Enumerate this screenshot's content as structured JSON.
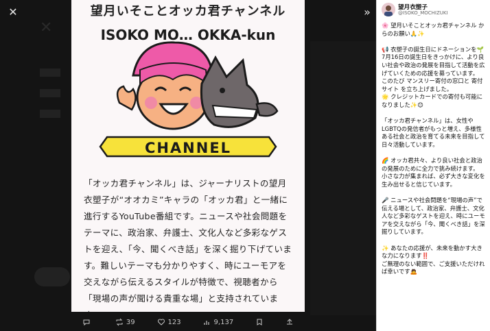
{
  "top": {
    "close_glyph": "✕",
    "expand_glyph": "»"
  },
  "card": {
    "title": "望月いそことオッカ君チャンネル",
    "logo": {
      "arc_text": "ISOKO MO… OKKA-kun",
      "banner": "CHANNEL"
    },
    "body": "「オッカ君チャンネル」は、ジャーナリストの望月衣塑子が“オオカミ”キャラの「オッカ君」と一緒に進行するYouTube番組です。ニュースや社会問題をテーマに、政治家、弁護士、文化人など多彩なゲストを迎え、「今、聞くべき話」を深く掘り下げています。難しいテーマも分かりやすく、時にユーモアを交えながら伝えるスタイルが特徴で、視聴者から「現場の声が聞ける貴重な場」と支持されています。"
  },
  "actions": {
    "reply": "",
    "retweets": "39",
    "likes": "123",
    "views": "9,137"
  },
  "sidebar": {
    "name": "望月衣塑子",
    "handle": "@ISOKO_MOCHIZUKI",
    "text": "🌸 望月いそことオッカ君チャンネル からのお願い🙏✨\n\n📢 衣塑子の誕生日にドネーションを🌱\n7月16日の誕生日をきっかけに、より良い社会や政治の発展を目指して活動を広げていくための応援を募っています。\nこのたび マンスリー寄付の窓口と 寄付サイト を立ち上げました。\n🌟 クレジットカードでの寄付も可能になりました✨😊\n\n「オッカ君チャンネル」は、女性やLGBTQの発信者がもっと増え、多様性ある社会と政治を育てる未来を目指して日々活動しています。\n\n🌈 オッカ君共々、より良い社会と政治の発展のために全力で挑み続けます。\n小さな力が集まれば、必ず大きな変化を生み出せると信じています。\n\n🎤 ニュースや社会問題を“現場の声”で伝える場として、政治家、弁護士、文化人など多彩なゲストを迎え、時にユーモアを交えながら「今、聞くべき話」を深掘りしています。\n\n✨ あなたの応援が、未来を動かす大きな力になります‼️\nご無理のない範囲で、ご支援いただければ幸いです🙇"
  }
}
